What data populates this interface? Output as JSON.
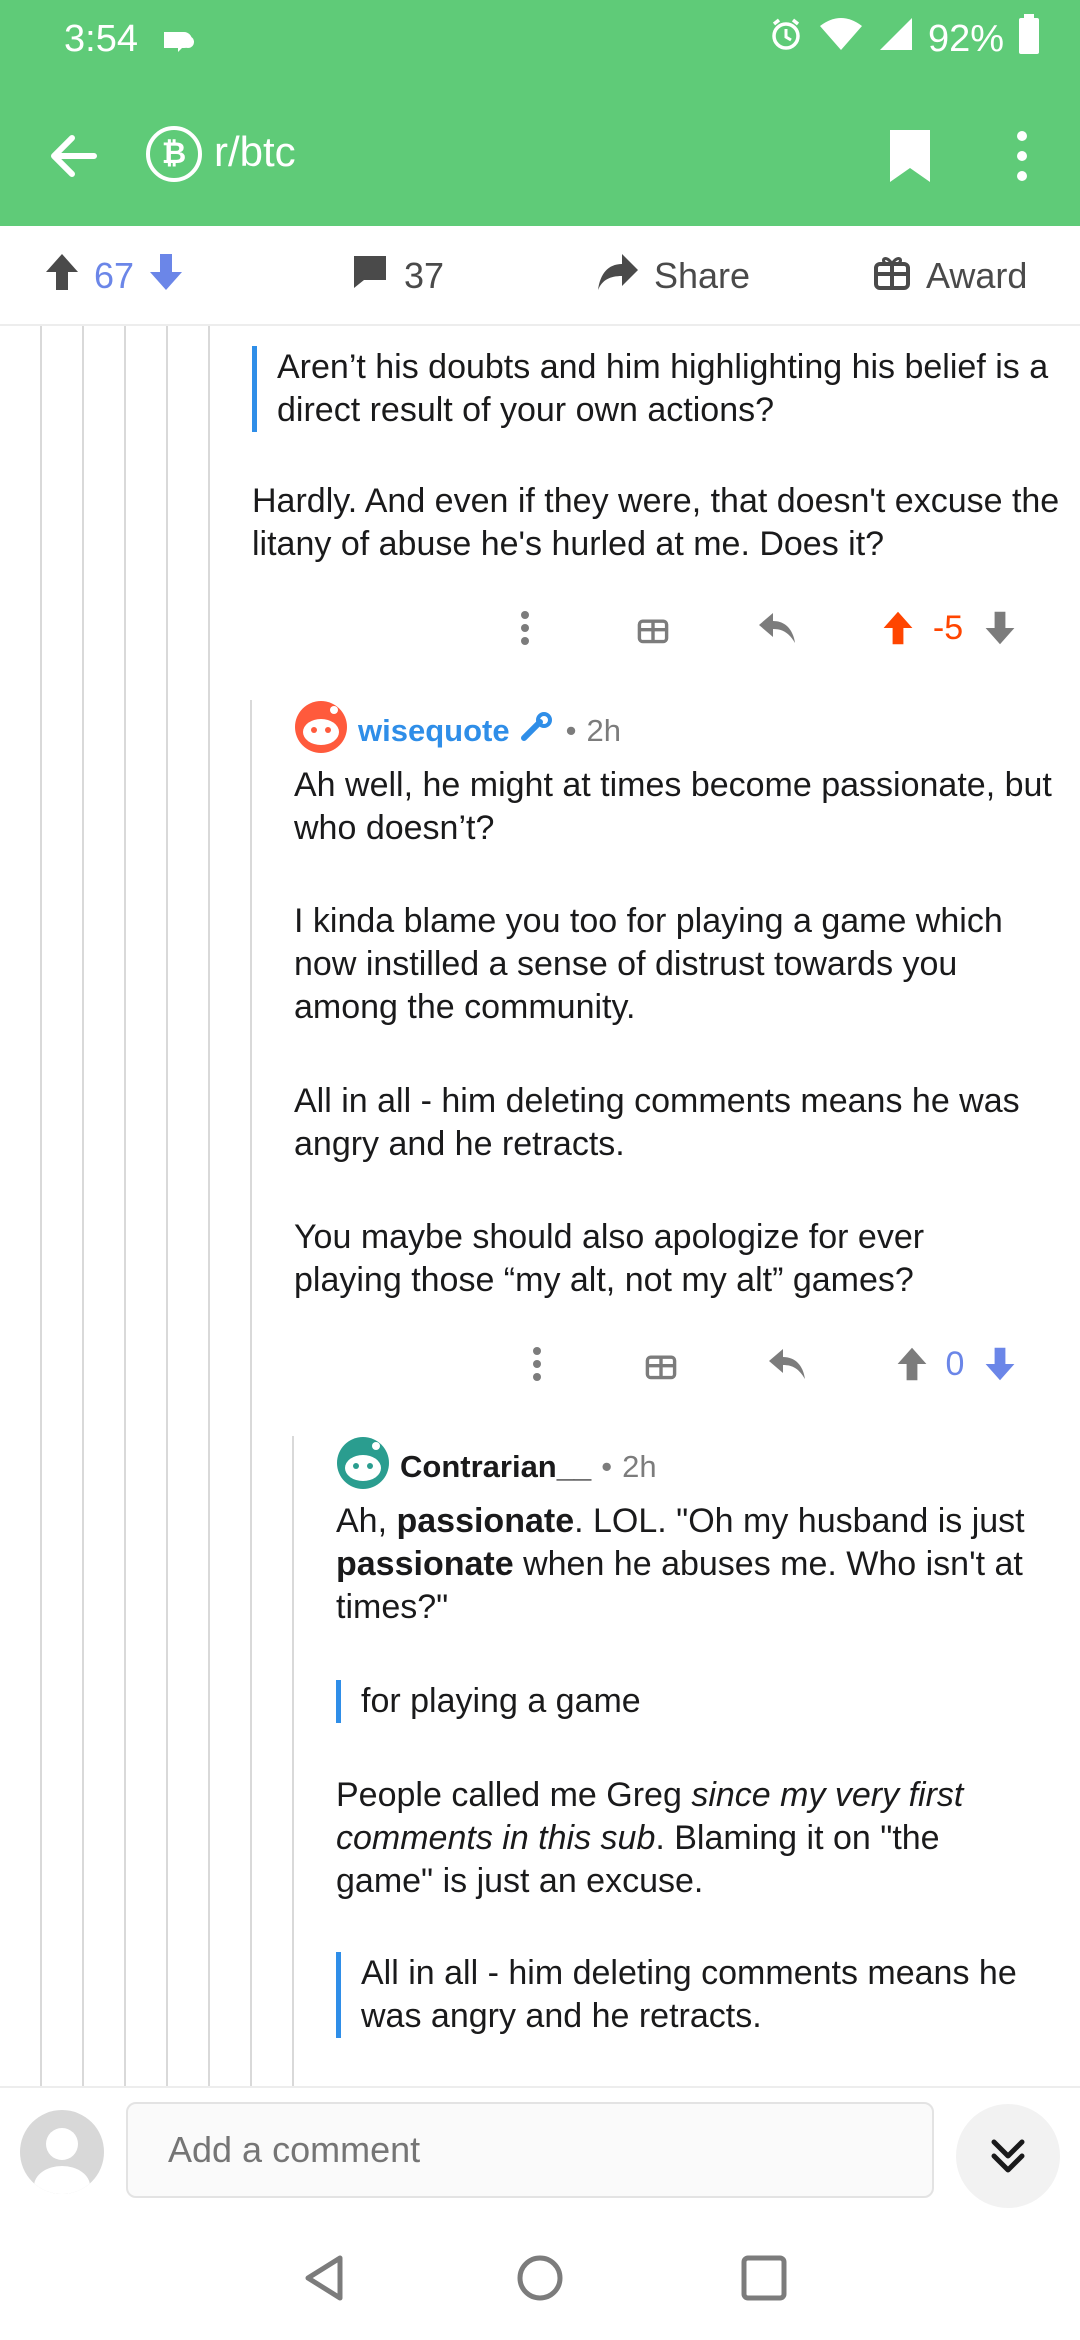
{
  "status": {
    "time": "3:54",
    "battery": "92%"
  },
  "header": {
    "subreddit": "r/btc",
    "sub_icon_glyph": "₿"
  },
  "post_actions": {
    "score": "67",
    "comments": "37",
    "share": "Share",
    "award": "Award"
  },
  "comment1": {
    "quote": "Aren’t his doubts and him highlighting his belief is a direct result of your own actions?",
    "body": "Hardly. And even if they were, that doesn't excuse the litany of abuse he's hurled at me. Does it?",
    "score": "-5"
  },
  "comment2": {
    "author": "wisequote",
    "time": "2h",
    "paragraphs": [
      "Ah well, he might at times become passionate, but who doesn’t?",
      "I kinda blame you too for playing a game which now instilled a sense of distrust towards you among the community.",
      "All in all - him deleting comments means he was angry and he retracts.",
      "You maybe should also apologize for ever playing those “my alt, not my alt” games?"
    ],
    "score": "0"
  },
  "comment3": {
    "author": "Contrarian__",
    "time": "2h",
    "p1_a": "Ah, ",
    "p1_bold1": "passionate",
    "p1_b": ". LOL. \"Oh my husband is just ",
    "p1_bold2": "passionate",
    "p1_c": " when he abuses me. Who isn't at times?\"",
    "quote1": "for playing a game",
    "p2_a": "People called me Greg ",
    "p2_italic": "since my very first comments in this sub",
    "p2_b": ". Blaming it on \"the game\" is just an excuse.",
    "quote2": "All in all - him deleting comments means he was angry and he retracts."
  },
  "bottom": {
    "placeholder": "Add a comment"
  },
  "colors": {
    "header_green": "#5fcb78",
    "upvote_orange": "#ff4500",
    "downvote_blue": "#6b86e8",
    "link_blue": "#2f8ee8"
  }
}
